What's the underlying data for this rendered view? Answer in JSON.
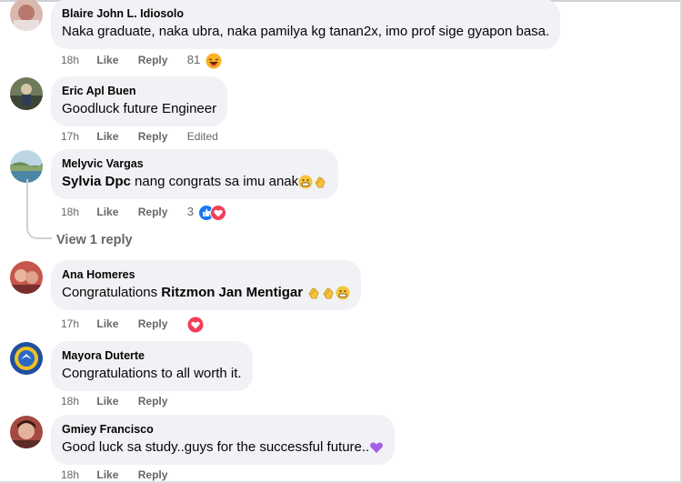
{
  "comments": [
    {
      "author": "Blaire John L. Idiosolo",
      "text": "Naka graduate, naka ubra, naka pamilya kg tanan2x, imo prof sige gyapon basa.",
      "time": "18h",
      "like": "Like",
      "reply": "Reply",
      "reaction_count": "81",
      "reaction_icon": "laughing-face-emoji"
    },
    {
      "author": "Eric Apl Buen",
      "text": "Goodluck future Engineer",
      "time": "17h",
      "like": "Like",
      "reply": "Reply",
      "edited": "Edited"
    },
    {
      "author": "Melyvic Vargas",
      "mention": "Sylvia Dpc",
      "text": " nang congrats sa imu anak",
      "time": "18h",
      "like": "Like",
      "reply": "Reply",
      "reaction_count": "3",
      "reaction_icons": [
        "like-icon",
        "love-icon"
      ],
      "view_replies": "View 1 reply"
    },
    {
      "author": "Ana Homeres",
      "text_prefix": "Congratulations ",
      "mention": "Ritzmon Jan Mentigar",
      "time": "17h",
      "like": "Like",
      "reply": "Reply",
      "reaction_icons": [
        "love-icon"
      ]
    },
    {
      "author": "Mayora Duterte",
      "text": "Congratulations to all worth it.",
      "time": "18h",
      "like": "Like",
      "reply": "Reply"
    },
    {
      "author": "Gmiey Francisco",
      "text": "Good luck sa study..guys for the successful future..",
      "time": "18h",
      "like": "Like",
      "reply": "Reply"
    }
  ],
  "colors": {
    "bubble": "#f0f2f5",
    "meta_text": "#65676b",
    "like_blue": "#1877f2",
    "love_red": "#f33e58"
  }
}
